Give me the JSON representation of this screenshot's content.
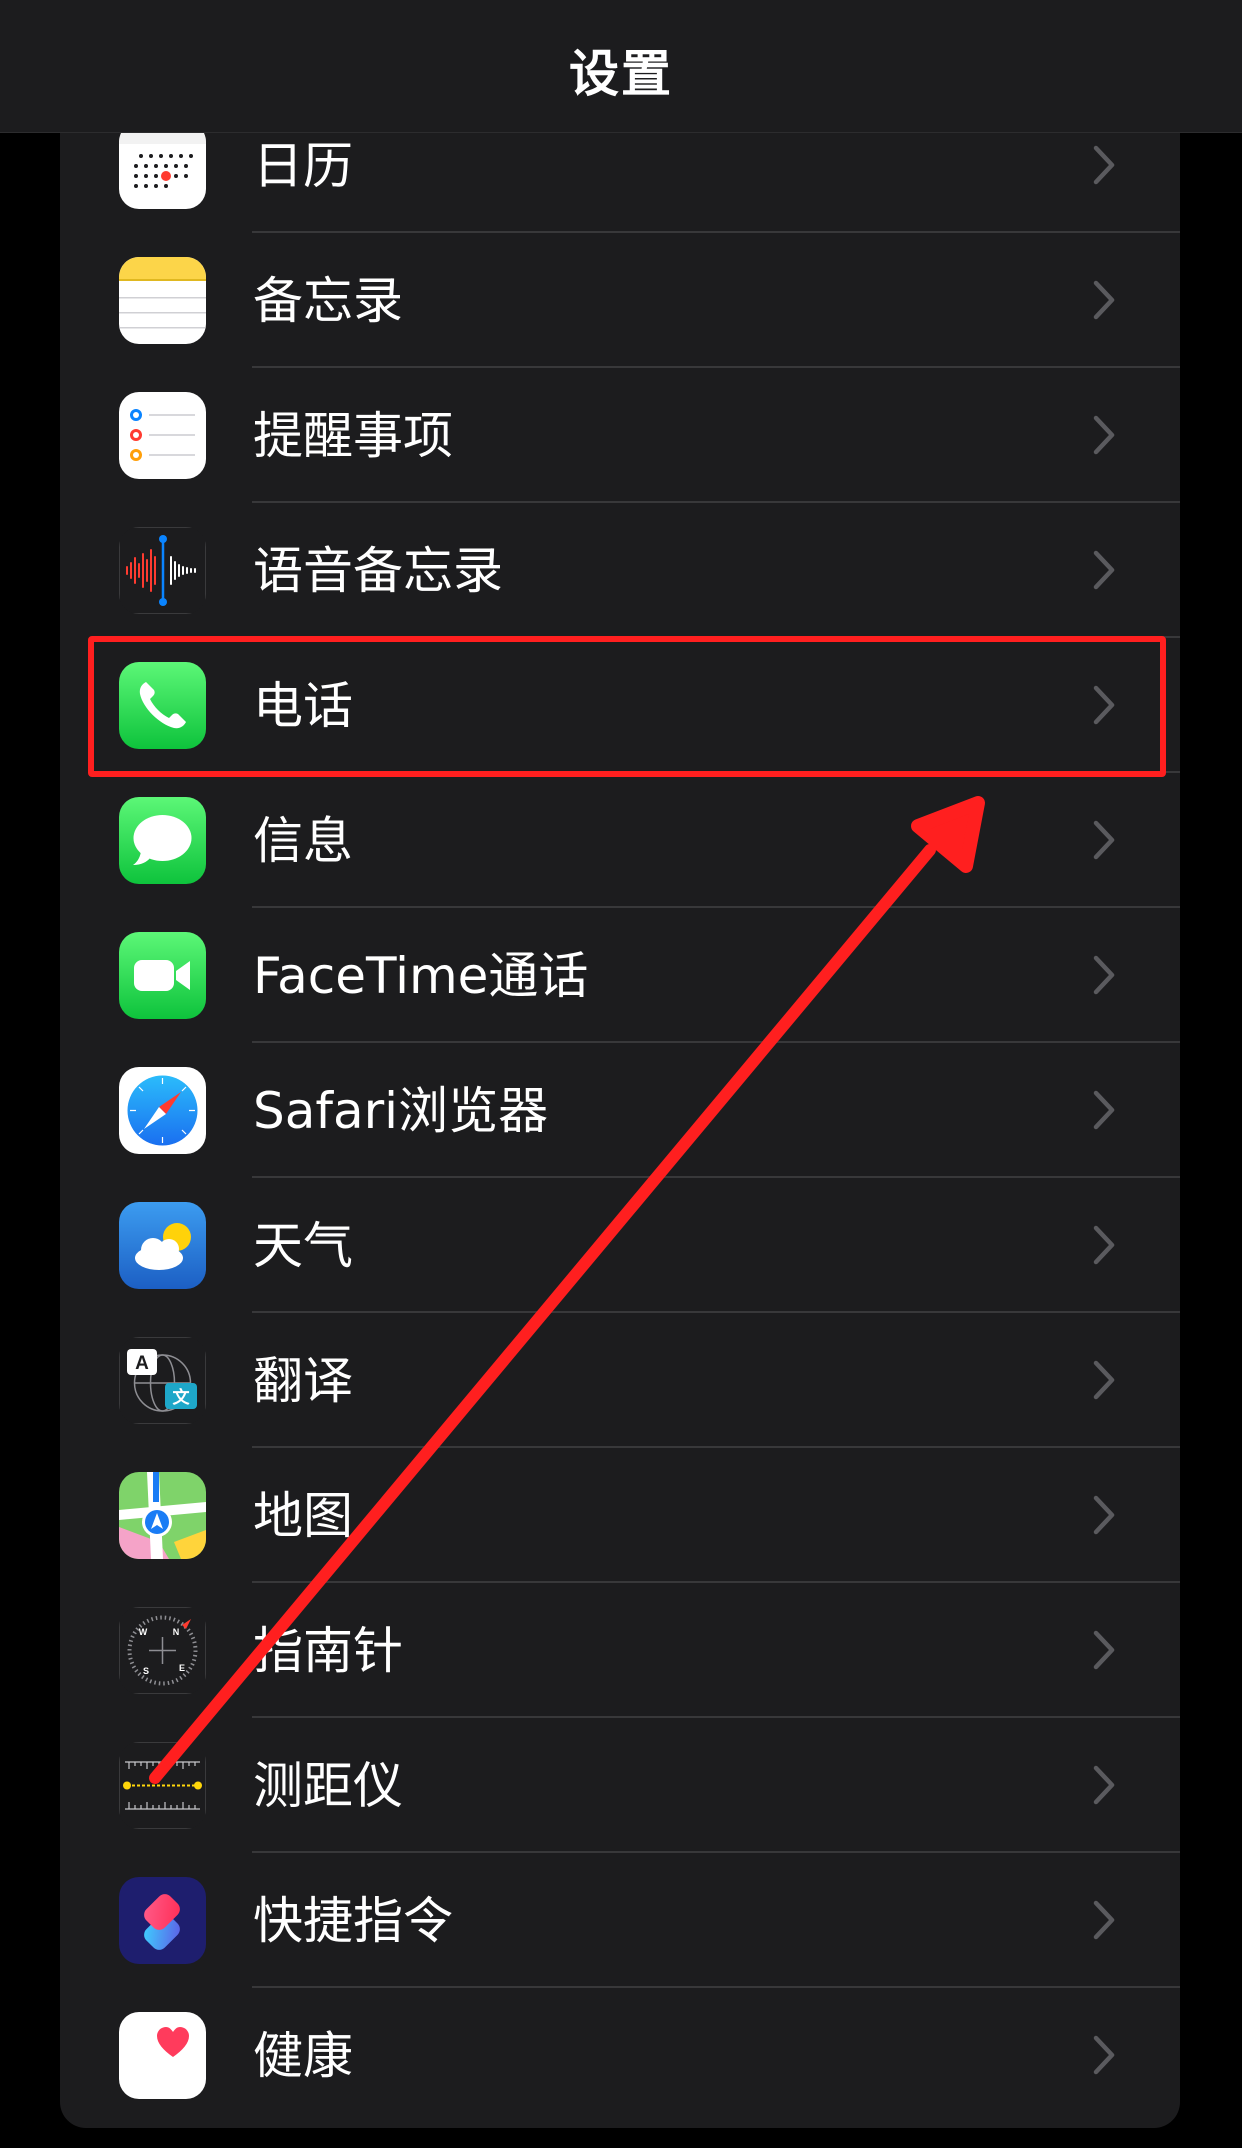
{
  "header": {
    "title": "设置"
  },
  "settings_rows": [
    {
      "label": "日历",
      "icon": "calendar-icon"
    },
    {
      "label": "备忘录",
      "icon": "notes-icon"
    },
    {
      "label": "提醒事项",
      "icon": "reminders-icon"
    },
    {
      "label": "语音备忘录",
      "icon": "voice-memos-icon"
    },
    {
      "label": "电话",
      "icon": "phone-icon"
    },
    {
      "label": "信息",
      "icon": "messages-icon"
    },
    {
      "label": "FaceTime通话",
      "icon": "facetime-icon"
    },
    {
      "label": "Safari浏览器",
      "icon": "safari-icon"
    },
    {
      "label": "天气",
      "icon": "weather-icon"
    },
    {
      "label": "翻译",
      "icon": "translate-icon"
    },
    {
      "label": "地图",
      "icon": "maps-icon"
    },
    {
      "label": "指南针",
      "icon": "compass-icon"
    },
    {
      "label": "测距仪",
      "icon": "measure-icon"
    },
    {
      "label": "快捷指令",
      "icon": "shortcuts-icon"
    },
    {
      "label": "健康",
      "icon": "health-icon"
    }
  ],
  "translate_icon_glyphs": {
    "left": "A",
    "right": "文"
  },
  "compass_icon_letters": {
    "n": "N",
    "e": "E",
    "s": "S",
    "w": "W"
  },
  "annotation": {
    "highlighted_row": "电话",
    "color": "#ff1f1f"
  },
  "colors": {
    "background": "#000000",
    "group_background": "#1c1c1e",
    "separator": "#38383a",
    "chevron": "#5a5a5e",
    "text": "#ffffff"
  }
}
